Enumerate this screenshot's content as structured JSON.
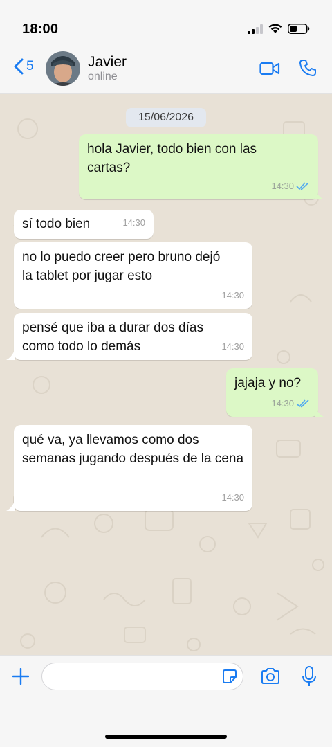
{
  "status_bar": {
    "time": "18:00"
  },
  "header": {
    "back_count": "5",
    "contact_name": "Javier",
    "contact_status": "online"
  },
  "chat": {
    "date": "15/06/2026",
    "messages": [
      {
        "direction": "out",
        "text": "hola Javier, todo bien con las cartas?",
        "time": "14:30",
        "read": true
      },
      {
        "direction": "in",
        "text": "sí todo bien",
        "time": "14:30"
      },
      {
        "direction": "in",
        "text": "no lo puedo creer pero bruno dejó la tablet por jugar esto",
        "time": "14:30"
      },
      {
        "direction": "in",
        "text": "pensé que iba a durar dos días como todo lo demás",
        "time": "14:30"
      },
      {
        "direction": "out",
        "text": "jajaja y no?",
        "time": "14:30",
        "read": true
      },
      {
        "direction": "in",
        "text": "qué va, ya llevamos como dos semanas jugando después de la cena",
        "time": "14:30"
      }
    ]
  },
  "composer": {
    "placeholder": ""
  },
  "colors": {
    "accent": "#1a7cf2",
    "outgoing": "#dcf8c6",
    "incoming": "#ffffff",
    "wallpaper": "#e8e1d6",
    "read_ticks": "#4fa8f0"
  }
}
